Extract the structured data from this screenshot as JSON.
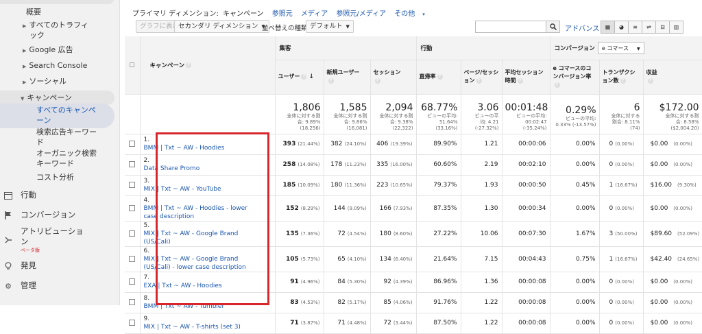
{
  "sidebar": {
    "top_item": "概要",
    "items": [
      {
        "label": "すべてのトラフィック",
        "lines": [
          "すべてのトラフィ",
          "ック"
        ]
      },
      {
        "label": "Google 広告"
      },
      {
        "label": "Search Console"
      },
      {
        "label": "ソーシャル"
      },
      {
        "label": "キャンペーン"
      }
    ],
    "sub_items": [
      {
        "label": "すべてのキャンペーン",
        "lines": [
          "すべてのキャンペ",
          "ーン"
        ]
      },
      {
        "label": "検索広告キーワード",
        "lines": [
          "検索広告キーワー",
          "ド"
        ]
      },
      {
        "label": "オーガニック検索キーワード",
        "lines": [
          "オーガニック検索",
          "キーワード"
        ]
      },
      {
        "label": "コスト分析",
        "lines": [
          "コスト分析"
        ]
      }
    ],
    "sections": [
      {
        "label": "行動",
        "icon": "behavior-icon"
      },
      {
        "label": "コンバージョン",
        "icon": "flag-icon"
      },
      {
        "label": "アトリビューション",
        "lines": [
          "アトリビューショ",
          "ン"
        ],
        "badge": "ベータ版",
        "icon": "attribution-icon"
      },
      {
        "label": "発見",
        "icon": "lightbulb-icon"
      },
      {
        "label": "管理",
        "icon": "gear-icon"
      }
    ]
  },
  "primary_dimension": {
    "label": "プライマリ ディメンション:",
    "selected": "キャンペーン",
    "options": [
      "参照元",
      "メディア",
      "参照元/メディア",
      "その他"
    ]
  },
  "toolbar": {
    "plot_rows": "グラフに表示",
    "secondary_dimension": "セカンダリ ディメンション",
    "sort_label": "並べ替えの種類:",
    "sort_value": "デフォルト",
    "search_placeholder": "",
    "advanced": "アドバンス"
  },
  "table": {
    "group_headers": {
      "acquisition": "集客",
      "behavior": "行動",
      "conversion": "コンバージョン",
      "conversion_select": "e コマース"
    },
    "columns": {
      "campaign": "キャンペーン",
      "users": "ユーザー",
      "new_users": "新規ユーザー",
      "sessions": "セッション",
      "bounce_rate": "直帰率",
      "pages_per_session": "ページ/セッション",
      "avg_session_duration": "平均セッション時間",
      "ecommerce_conversion_rate": "e コマースのコンバージョン率",
      "transactions": "トランザクション数",
      "revenue": "収益"
    },
    "totals": {
      "users": {
        "value": "1,806",
        "sub": [
          "全体に対する割",
          "合: 9.89%",
          "(18,256)"
        ]
      },
      "new_users": {
        "value": "1,585",
        "sub": [
          "全体に対する割",
          "合: 9.86%",
          "(16,081)"
        ]
      },
      "sessions": {
        "value": "2,094",
        "sub": [
          "全体に対する割",
          "合: 9.38%",
          "(22,322)"
        ]
      },
      "bounce_rate": {
        "value": "68.77%",
        "sub": [
          "ビューの平均:",
          "51.64%",
          "(33.16%)"
        ]
      },
      "pages_per_session": {
        "value": "3.06",
        "sub": [
          "ビューの平",
          "均: 4.21",
          "(-27.32%)"
        ]
      },
      "avg_session_duration": {
        "value": "00:01:48",
        "sub": [
          "ビューの平均:",
          "00:02:47",
          "(-35.24%)"
        ]
      },
      "ecommerce_conversion_rate": {
        "value": "0.29%",
        "sub": [
          "ビューの平均:",
          "0.33% (-13.57%)"
        ]
      },
      "transactions": {
        "value": "6",
        "sub": [
          "全体に対する",
          "割合: 8.11%",
          "(74)"
        ]
      },
      "revenue": {
        "value": "$172.00",
        "sub": [
          "全体に対する割",
          "合: 8.58%",
          "($2,004.20)"
        ]
      }
    },
    "rows": [
      {
        "idx": "1.",
        "campaign": "BMM | Txt ~ AW - Hoodies",
        "users": "393",
        "users_pct": "(21.44%)",
        "new_users": "382",
        "new_users_pct": "(24.10%)",
        "sessions": "406",
        "sessions_pct": "(19.39%)",
        "bounce": "89.90%",
        "pps": "1.21",
        "dur": "00:00:06",
        "conv": "0.00%",
        "trans": "0",
        "trans_pct": "(0.00%)",
        "rev": "$0.00",
        "rev_pct": "(0.00%)"
      },
      {
        "idx": "2.",
        "campaign": "Data Share Promo",
        "users": "258",
        "users_pct": "(14.08%)",
        "new_users": "178",
        "new_users_pct": "(11.23%)",
        "sessions": "335",
        "sessions_pct": "(16.00%)",
        "bounce": "60.60%",
        "pps": "2.19",
        "dur": "00:02:10",
        "conv": "0.00%",
        "trans": "0",
        "trans_pct": "(0.00%)",
        "rev": "$0.00",
        "rev_pct": "(0.00%)"
      },
      {
        "idx": "3.",
        "campaign": "MIX | Txt ~ AW - YouTube",
        "users": "185",
        "users_pct": "(10.09%)",
        "new_users": "180",
        "new_users_pct": "(11.36%)",
        "sessions": "223",
        "sessions_pct": "(10.65%)",
        "bounce": "79.37%",
        "pps": "1.93",
        "dur": "00:00:50",
        "conv": "0.45%",
        "trans": "1",
        "trans_pct": "(16.67%)",
        "rev": "$16.00",
        "rev_pct": "(9.30%)"
      },
      {
        "idx": "4.",
        "campaign": "BMM | Txt ~ AW - Hoodies - lower case description",
        "users": "152",
        "users_pct": "(8.29%)",
        "new_users": "144",
        "new_users_pct": "(9.09%)",
        "sessions": "166",
        "sessions_pct": "(7.93%)",
        "bounce": "87.35%",
        "pps": "1.30",
        "dur": "00:00:34",
        "conv": "0.00%",
        "trans": "0",
        "trans_pct": "(0.00%)",
        "rev": "$0.00",
        "rev_pct": "(0.00%)"
      },
      {
        "idx": "5.",
        "campaign": "MIX | Txt ~ AW - Google Brand (US/Cali)",
        "users": "135",
        "users_pct": "(7.36%)",
        "new_users": "72",
        "new_users_pct": "(4.54%)",
        "sessions": "180",
        "sessions_pct": "(8.60%)",
        "bounce": "27.22%",
        "pps": "10.06",
        "dur": "00:07:30",
        "conv": "1.67%",
        "trans": "3",
        "trans_pct": "(50.00%)",
        "rev": "$89.60",
        "rev_pct": "(52.09%)"
      },
      {
        "idx": "6.",
        "campaign": "MIX | Txt ~ AW - Google Brand (US/Cali) - lower case description",
        "users": "105",
        "users_pct": "(5.73%)",
        "new_users": "65",
        "new_users_pct": "(4.10%)",
        "sessions": "134",
        "sessions_pct": "(6.40%)",
        "bounce": "21.64%",
        "pps": "7.15",
        "dur": "00:04:43",
        "conv": "0.75%",
        "trans": "1",
        "trans_pct": "(16.67%)",
        "rev": "$42.40",
        "rev_pct": "(24.65%)"
      },
      {
        "idx": "7.",
        "campaign": "EXA | Txt ~ AW - Hoodies",
        "users": "91",
        "users_pct": "(4.96%)",
        "new_users": "84",
        "new_users_pct": "(5.30%)",
        "sessions": "92",
        "sessions_pct": "(4.39%)",
        "bounce": "86.96%",
        "pps": "1.36",
        "dur": "00:00:08",
        "conv": "0.00%",
        "trans": "0",
        "trans_pct": "(0.00%)",
        "rev": "$0.00",
        "rev_pct": "(0.00%)"
      },
      {
        "idx": "8.",
        "campaign": "BMM | Txt ~ AW - Tumbler",
        "users": "83",
        "users_pct": "(4.53%)",
        "new_users": "82",
        "new_users_pct": "(5.17%)",
        "sessions": "85",
        "sessions_pct": "(4.06%)",
        "bounce": "91.76%",
        "pps": "1.22",
        "dur": "00:00:08",
        "conv": "0.00%",
        "trans": "0",
        "trans_pct": "(0.00%)",
        "rev": "$0.00",
        "rev_pct": "(0.00%)"
      },
      {
        "idx": "9.",
        "campaign": "MIX | Txt ~ AW - T-shirts (set 3)",
        "users": "71",
        "users_pct": "(3.87%)",
        "new_users": "71",
        "new_users_pct": "(4.48%)",
        "sessions": "72",
        "sessions_pct": "(3.44%)",
        "bounce": "87.50%",
        "pps": "1.22",
        "dur": "00:00:08",
        "conv": "0.00%",
        "trans": "0",
        "trans_pct": "(0.00%)",
        "rev": "$0.00",
        "rev_pct": "(0.00%)"
      }
    ]
  },
  "colors": {
    "link": "#1a56b0",
    "highlight_border": "#d7262c",
    "sidebar_bg": "#f1f1f1",
    "header_bg": "#f3f3f3"
  }
}
